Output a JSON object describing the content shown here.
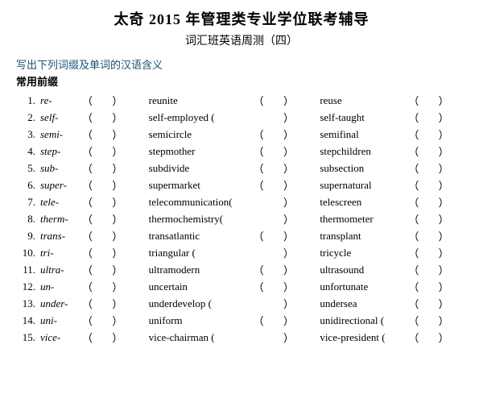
{
  "title": "太奇 2015 年管理类专业学位联考辅导",
  "subtitle": "词汇班英语周测（四）",
  "instruction": "写出下列词缀及单词的汉语含义",
  "section": "常用前缀",
  "rows": [
    {
      "num": "1.",
      "prefix": "re-",
      "w2": "reunite",
      "w3": "reuse"
    },
    {
      "num": "2.",
      "prefix": "self-",
      "w2": "self-employed (",
      "w3": "self-taught"
    },
    {
      "num": "3.",
      "prefix": "semi-",
      "w2": "semicircle",
      "w3": "semifinal"
    },
    {
      "num": "4.",
      "prefix": "step-",
      "w2": "stepmother",
      "w3": "stepchildren"
    },
    {
      "num": "5.",
      "prefix": "sub-",
      "w2": "subdivide",
      "w3": "subsection"
    },
    {
      "num": "6.",
      "prefix": "super-",
      "w2": "supermarket",
      "w3": "supernatural"
    },
    {
      "num": "7.",
      "prefix": "tele-",
      "w2": "telecommunication(",
      "w3": "telescreen"
    },
    {
      "num": "8.",
      "prefix": "therm-",
      "w2": "thermochemistry(",
      "w3": "thermometer"
    },
    {
      "num": "9.",
      "prefix": "trans-",
      "w2": "transatlantic",
      "w3": "transplant"
    },
    {
      "num": "10.",
      "prefix": "tri-",
      "w2": "triangular (",
      "w3": "tricycle"
    },
    {
      "num": "11.",
      "prefix": "ultra-",
      "w2": "ultramodern",
      "w3": "ultrasound"
    },
    {
      "num": "12.",
      "prefix": "un-",
      "w2": "uncertain",
      "w3": "unfortunate"
    },
    {
      "num": "13.",
      "prefix": "under-",
      "w2": "underdevelop (",
      "w3": "undersea"
    },
    {
      "num": "14.",
      "prefix": "uni-",
      "w2": "uniform",
      "w3": "unidirectional ("
    },
    {
      "num": "15.",
      "prefix": "vice-",
      "w2": "vice-chairman (",
      "w3": "vice-president ("
    }
  ]
}
